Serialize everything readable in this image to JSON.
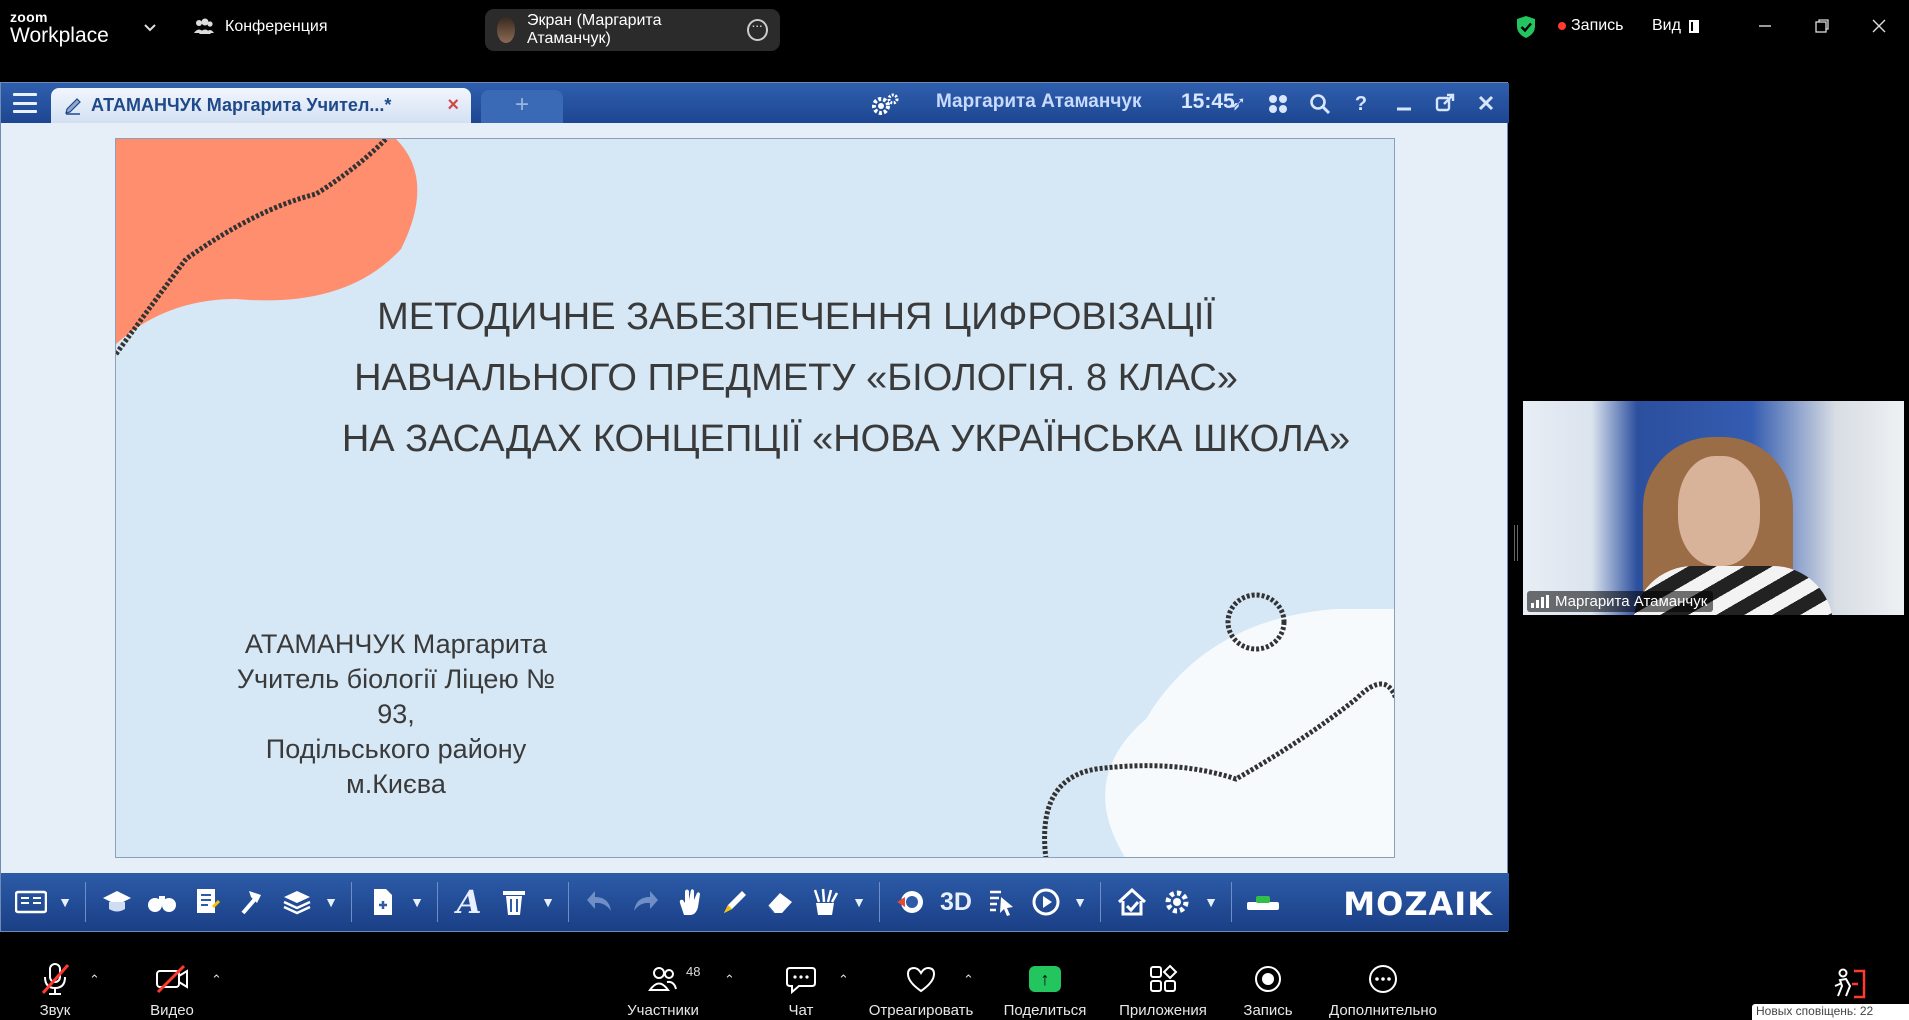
{
  "zoom": {
    "logo_top": "zoom",
    "logo_bottom": "Workplace",
    "conference_label": "Конференция",
    "screen_share_label": "Экран (Маргарита Атаманчук)",
    "recording_label": "Запись",
    "view_label": "Вид",
    "colors": {
      "background": "#000000",
      "recording": "#ff3b30",
      "security": "#23c55e"
    }
  },
  "mozaik": {
    "tab_title": "АТАМАНЧУК Маргарита Учител...*",
    "tab_close": "×",
    "new_tab": "+",
    "user_name": "Маргарита Атаманчук",
    "clock": "15:45",
    "logo": "MOZAIK",
    "toolbar_3d": "3D",
    "toolbar_text": "A",
    "colors": {
      "titlebar": "#1d4691",
      "accent": "#f5c400"
    }
  },
  "slide": {
    "title_line1": "МЕТОДИЧНЕ ЗАБЕЗПЕЧЕННЯ ЦИФРОВІЗАЦІЇ",
    "title_line2": "НАВЧАЛЬНОГО ПРЕДМЕТУ «БІОЛОГІЯ. 8 КЛАС»",
    "title_line3": "НА ЗАСАДАХ КОНЦЕПЦІЇ «НОВА УКРАЇНСЬКА ШКОЛА»",
    "author_line1": "АТАМАНЧУК Маргарита",
    "author_line2": "Учитель біології Ліцею № 93,",
    "author_line3": "Подільського району м.Києва",
    "colors": {
      "background": "#d6e8f6",
      "blob": "#ff8e6e",
      "text": "#3a3a3a"
    }
  },
  "video": {
    "participant_name": "Маргарита Атаманчук"
  },
  "bottom_bar": {
    "audio": "Звук",
    "video": "Видео",
    "participants": "Участники",
    "participants_count": "48",
    "chat": "Чат",
    "react": "Отреагировать",
    "share": "Поделиться",
    "apps": "Приложения",
    "record": "Запись",
    "more": "Дополнительно"
  },
  "notification": "Новых сповіщень: 22"
}
